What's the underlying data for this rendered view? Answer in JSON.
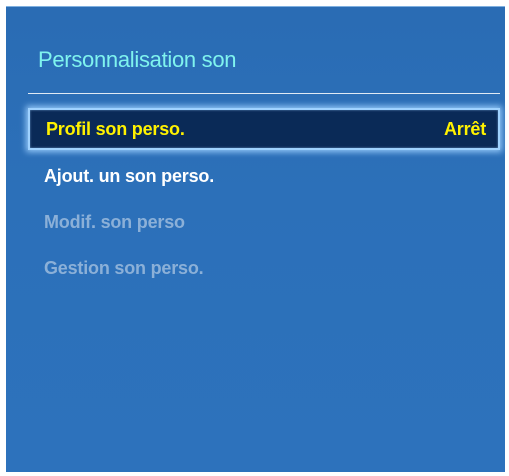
{
  "menu": {
    "title": "Personnalisation son",
    "items": [
      {
        "label": "Profil son perso.",
        "value": "Arrêt",
        "state": "selected"
      },
      {
        "label": "Ajout. un son perso.",
        "state": "enabled"
      },
      {
        "label": "Modif. son perso",
        "state": "disabled"
      },
      {
        "label": "Gestion son perso.",
        "state": "disabled"
      }
    ]
  },
  "colors": {
    "background": "#2c70b9",
    "title": "#7ff3ee",
    "selected_text": "#fff200",
    "selected_background": "#0a2a57",
    "highlight_border": "#9fd2ff",
    "enabled_text": "#ffffff",
    "disabled_text": "#8bb0d8"
  }
}
